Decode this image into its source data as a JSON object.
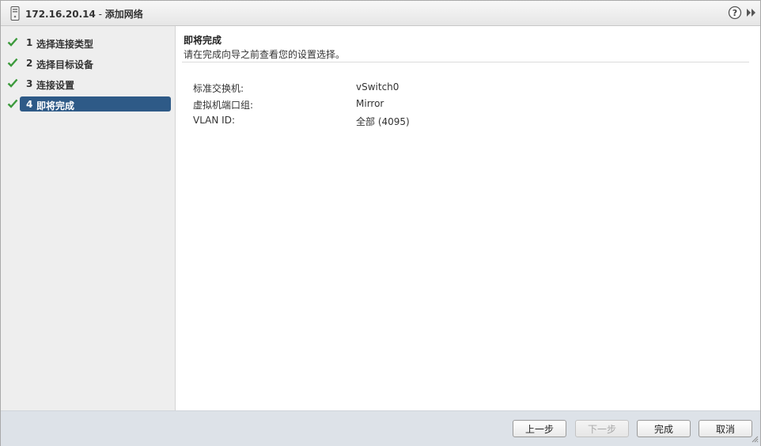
{
  "window": {
    "host": "172.16.20.14",
    "separator": " - ",
    "title": "添加网络"
  },
  "wizard": {
    "steps": [
      {
        "number": "1",
        "label": "选择连接类型",
        "completed": true,
        "active": false
      },
      {
        "number": "2",
        "label": "选择目标设备",
        "completed": true,
        "active": false
      },
      {
        "number": "3",
        "label": "连接设置",
        "completed": true,
        "active": false
      },
      {
        "number": "4",
        "label": "即将完成",
        "completed": true,
        "active": true
      }
    ]
  },
  "page": {
    "title": "即将完成",
    "subtitle": "请在完成向导之前查看您的设置选择。"
  },
  "summary": [
    {
      "key": "标准交换机:",
      "value": "vSwitch0"
    },
    {
      "key": "虚拟机端口组:",
      "value": "Mirror"
    },
    {
      "key": "VLAN ID:",
      "value": "全部 (4095)"
    }
  ],
  "footer": {
    "back_label": "上一步",
    "next_label": "下一步",
    "finish_label": "完成",
    "cancel_label": "取消"
  },
  "icons": {
    "host": "host-device-icon",
    "help": "help-icon",
    "collapse": "double-chevron-right-icon",
    "check": "check-icon",
    "resize": "resize-grip-icon"
  },
  "colors": {
    "active_step": "#2e5a87",
    "check": "#3c9a3c"
  }
}
